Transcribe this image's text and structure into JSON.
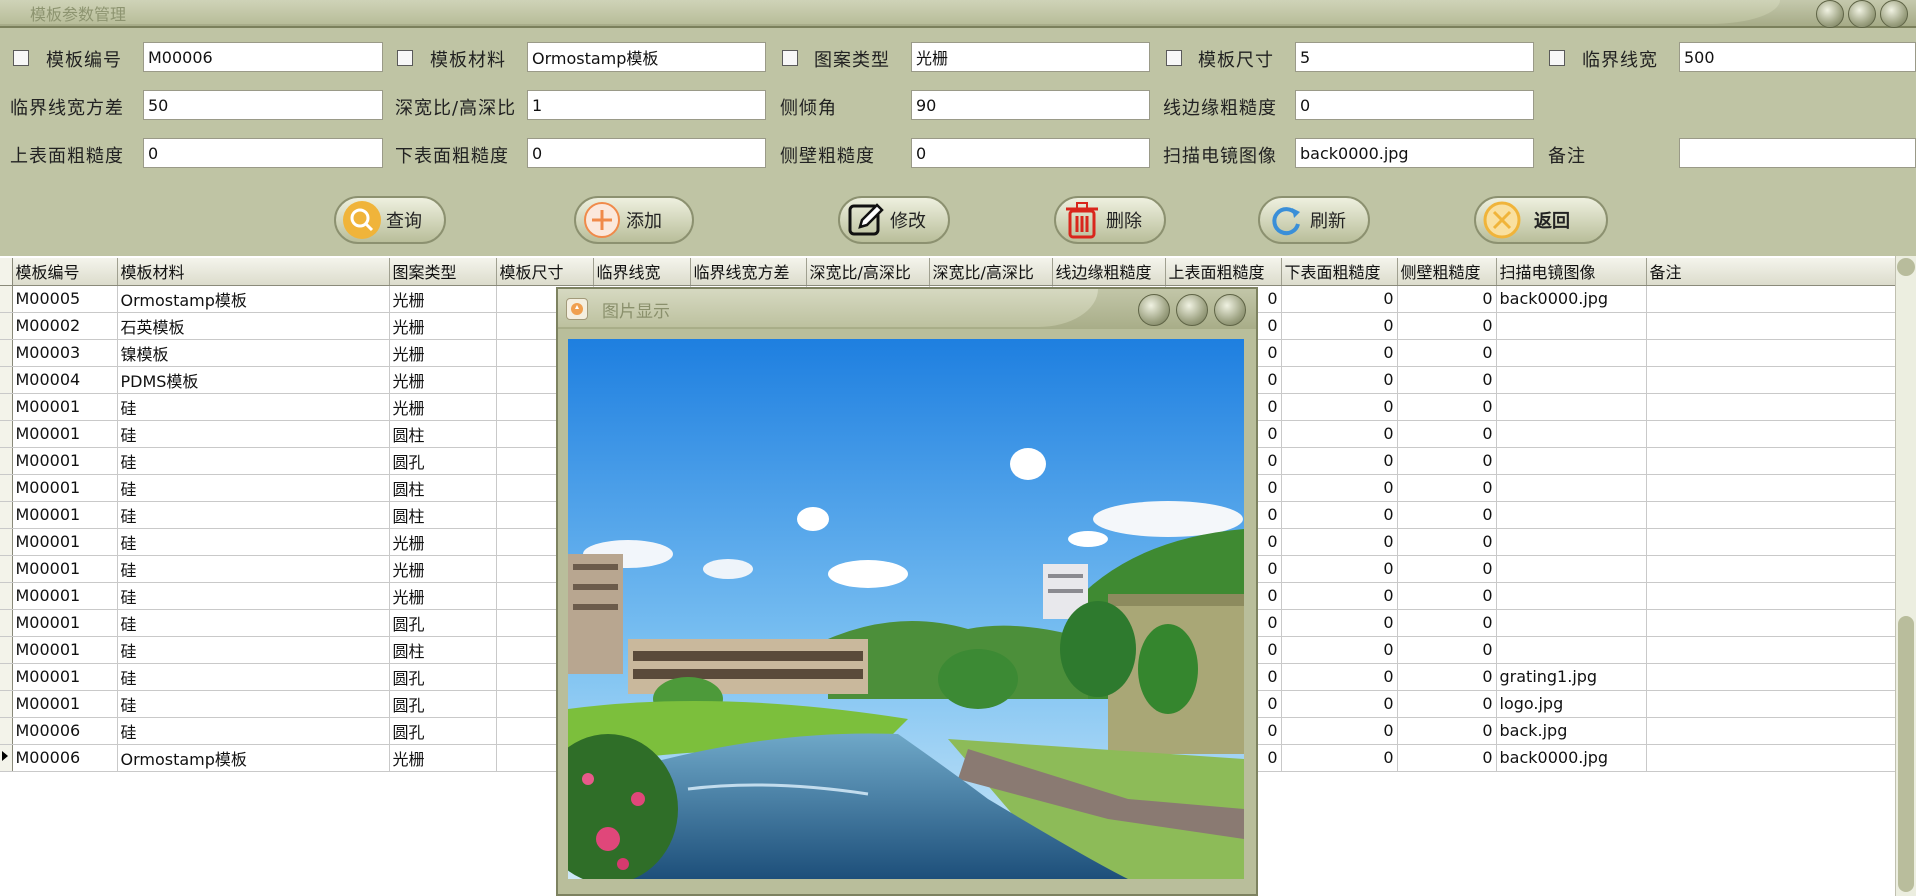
{
  "window": {
    "title": "模板参数管理"
  },
  "form": {
    "template_id": {
      "label": "模板编号",
      "value": "M00006"
    },
    "template_material": {
      "label": "模板材料",
      "value": "Ormostamp模板"
    },
    "pattern_type": {
      "label": "图案类型",
      "value": "光栅"
    },
    "template_size": {
      "label": "模板尺寸",
      "value": "5"
    },
    "critical_linewidth": {
      "label": "临界线宽",
      "value": "500"
    },
    "linewidth_variance": {
      "label": "临界线宽方差",
      "value": "50"
    },
    "aspect_ratio": {
      "label": "深宽比/高深比",
      "value": "1"
    },
    "sidewall_angle": {
      "label": "侧倾角",
      "value": "90"
    },
    "line_edge_roughness": {
      "label": "线边缘粗糙度",
      "value": "0"
    },
    "top_roughness": {
      "label": "上表面粗糙度",
      "value": "0"
    },
    "bottom_roughness": {
      "label": "下表面粗糙度",
      "value": "0"
    },
    "sidewall_roughness": {
      "label": "侧壁粗糙度",
      "value": "0"
    },
    "sem_image": {
      "label": "扫描电镜图像",
      "value": "back0000.jpg"
    },
    "remarks": {
      "label": "备注",
      "value": ""
    }
  },
  "buttons": {
    "query": "查询",
    "add": "添加",
    "modify": "修改",
    "delete": "删除",
    "refresh": "刷新",
    "back": "返回"
  },
  "table": {
    "columns": [
      "模板编号",
      "模板材料",
      "图案类型",
      "模板尺寸",
      "临界线宽",
      "临界线宽方差",
      "深宽比/高深比",
      "深宽比/高深比",
      "线边缘粗糙度",
      "上表面粗糙度",
      "下表面粗糙度",
      "侧壁粗糙度",
      "扫描电镜图像",
      "备注"
    ],
    "rows": [
      [
        "M00005",
        "Ormostamp模板",
        "光栅",
        "",
        "",
        "",
        "",
        "",
        "",
        "0",
        "0",
        "0",
        "back0000.jpg",
        ""
      ],
      [
        "M00002",
        "石英模板",
        "光栅",
        "",
        "",
        "",
        "",
        "",
        "",
        "0",
        "0",
        "0",
        "",
        ""
      ],
      [
        "M00003",
        "镍模板",
        "光栅",
        "",
        "",
        "",
        "",
        "",
        "",
        "0",
        "0",
        "0",
        "",
        ""
      ],
      [
        "M00004",
        "PDMS模板",
        "光栅",
        "",
        "",
        "",
        "",
        "",
        "",
        "0",
        "0",
        "0",
        "",
        ""
      ],
      [
        "M00001",
        "硅",
        "光栅",
        "",
        "",
        "",
        "",
        "",
        "",
        "0",
        "0",
        "0",
        "",
        ""
      ],
      [
        "M00001",
        "硅",
        "圆柱",
        "",
        "",
        "",
        "",
        "",
        "",
        "0",
        "0",
        "0",
        "",
        ""
      ],
      [
        "M00001",
        "硅",
        "圆孔",
        "",
        "",
        "",
        "",
        "",
        "",
        "0",
        "0",
        "0",
        "",
        ""
      ],
      [
        "M00001",
        "硅",
        "圆柱",
        "",
        "",
        "",
        "",
        "",
        "",
        "0",
        "0",
        "0",
        "",
        ""
      ],
      [
        "M00001",
        "硅",
        "圆柱",
        "",
        "",
        "",
        "",
        "",
        "",
        "0",
        "0",
        "0",
        "",
        ""
      ],
      [
        "M00001",
        "硅",
        "光栅",
        "",
        "",
        "",
        "",
        "",
        "",
        "0",
        "0",
        "0",
        "",
        ""
      ],
      [
        "M00001",
        "硅",
        "光栅",
        "",
        "",
        "",
        "",
        "",
        "",
        "0",
        "0",
        "0",
        "",
        ""
      ],
      [
        "M00001",
        "硅",
        "光栅",
        "",
        "",
        "",
        "",
        "",
        "",
        "0",
        "0",
        "0",
        "",
        ""
      ],
      [
        "M00001",
        "硅",
        "圆孔",
        "",
        "",
        "",
        "",
        "",
        "",
        "0",
        "0",
        "0",
        "",
        ""
      ],
      [
        "M00001",
        "硅",
        "圆柱",
        "",
        "",
        "",
        "",
        "",
        "",
        "0",
        "0",
        "0",
        "",
        ""
      ],
      [
        "M00001",
        "硅",
        "圆孔",
        "",
        "",
        "",
        "",
        "",
        "",
        "0",
        "0",
        "0",
        "grating1.jpg",
        ""
      ],
      [
        "M00001",
        "硅",
        "圆孔",
        "",
        "",
        "",
        "",
        "",
        "",
        "0",
        "0",
        "0",
        "logo.jpg",
        ""
      ],
      [
        "M00006",
        "硅",
        "圆孔",
        "",
        "",
        "",
        "",
        "",
        "",
        "0",
        "0",
        "0",
        "back.jpg",
        ""
      ],
      [
        "M00006",
        "Ormostamp模板",
        "光栅",
        "",
        "",
        "",
        "",
        "",
        "",
        "0",
        "0",
        "0",
        "back0000.jpg",
        ""
      ]
    ],
    "current_row_index": 17
  },
  "image_dialog": {
    "title": "图片显示"
  },
  "colors": {
    "chrome": "#bfc4a4",
    "query_icon": "#f0b43a",
    "add_icon": "#f08a4a",
    "delete_icon": "#d9261c",
    "refresh_icon": "#3a8fd8",
    "back_icon": "#f0b43a"
  }
}
